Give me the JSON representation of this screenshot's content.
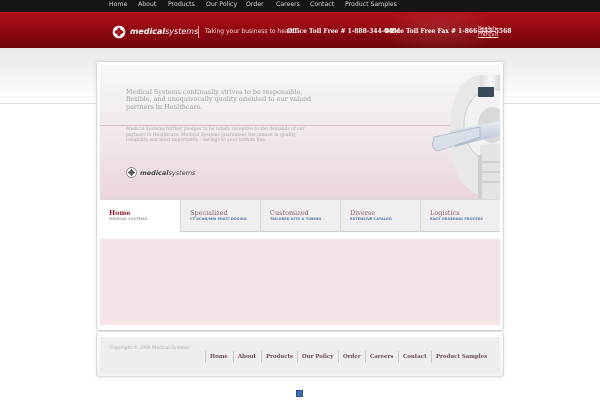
{
  "topnav": [
    "Home",
    "About",
    "Products",
    "Our Policy",
    "Order",
    "Careers",
    "Contact",
    "Product Samples"
  ],
  "header": {
    "logo_bold": "medical",
    "logo_rest": "systems",
    "tagline": "Taking your business to heart",
    "phone": "Office Toll Free # 1-888-344-4491",
    "fax": "Office Toll Free Fax # 1-866-553-5568",
    "lang_en": "English",
    "lang_fr": "Français",
    "accent": "#9e0c14"
  },
  "hero": {
    "lead": "Medical Systems continually strives to be responsible, flexible, and unequivocally quality oriented to our valued partners in Healthcare.",
    "sub": "Medical Systems further pledges to be totally receptive to the demands of our partners in Healthcare. Medical Systems guarantees the utmost in quality, reliability and most importantly - savings to your bottom line.",
    "logo_bold": "medical",
    "logo_rest": "systems"
  },
  "tabs": [
    {
      "title": "Home",
      "sub": "MEDICAL SYSTEMS",
      "active": true
    },
    {
      "title": "Specialized",
      "sub": "CT SCAN/MRI MULTI DOSING",
      "active": false
    },
    {
      "title": "Customized",
      "sub": "TAILORED KITS & TUBING",
      "active": false
    },
    {
      "title": "Diverse",
      "sub": "EXTENSIVE CATALOG",
      "active": false
    },
    {
      "title": "Logistics",
      "sub": "EASY ORDERING PROCESS",
      "active": false
    }
  ],
  "footer": {
    "copyright": "Copyright © 2008 Medical Systems",
    "nav": [
      "Home",
      "About",
      "Products",
      "Our Policy",
      "Order",
      "Careers",
      "Contact",
      "Product Samples"
    ]
  }
}
